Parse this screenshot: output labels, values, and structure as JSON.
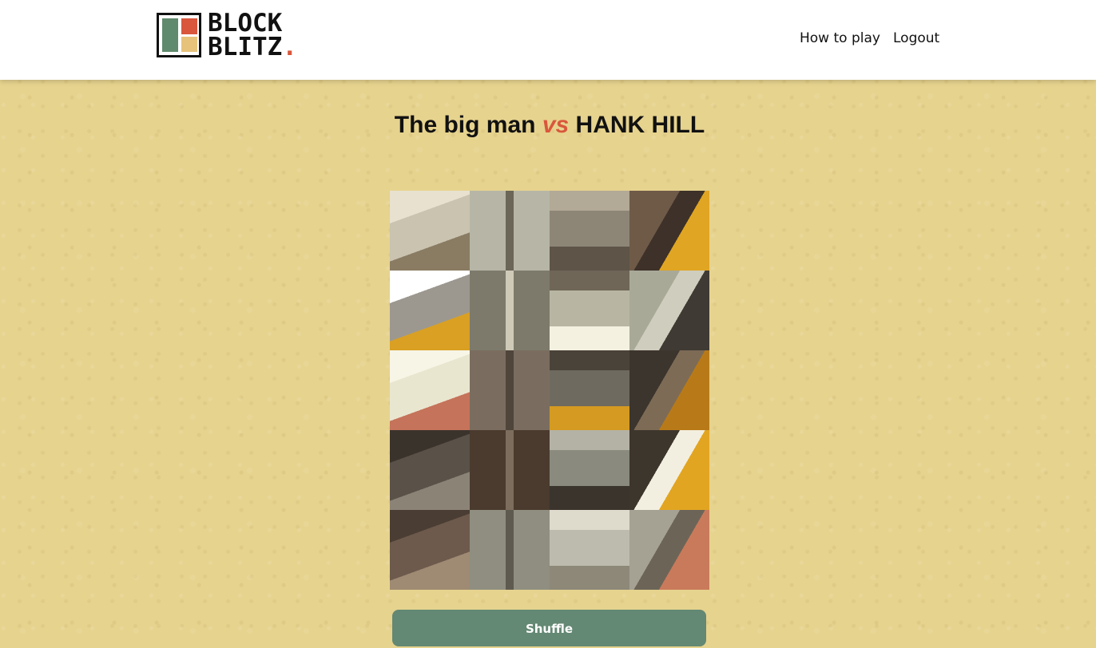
{
  "header": {
    "logo_line1": "BLOCK",
    "logo_line2": "BLITZ",
    "logo_dot": ".",
    "nav": {
      "how_to_play": "How to play",
      "logout": "Logout"
    }
  },
  "match": {
    "player1": "The big man",
    "vs": "vs",
    "player2": "HANK HILL"
  },
  "puzzle": {
    "tiles": [
      {
        "bg": "#c9c3b0",
        "accent": "#8a7b63",
        "accent2": "#e8e1cf"
      },
      {
        "bg": "#b7b6a6",
        "accent": "#d4a028",
        "accent2": "#6b6658"
      },
      {
        "bg": "#8d8677",
        "accent": "#5e5448",
        "accent2": "#b2a996"
      },
      {
        "bg": "#6f5a48",
        "accent": "#e0a523",
        "accent2": "#3d3129"
      },
      {
        "bg": "#9c9890",
        "accent": "#d9a023",
        "accent2": "#ffffff"
      },
      {
        "bg": "#7d7a6b",
        "accent": "#a9a591",
        "accent2": "#cfcab8"
      },
      {
        "bg": "#b8b6a3",
        "accent": "#f4f1e1",
        "accent2": "#6f6657"
      },
      {
        "bg": "#a9a998",
        "accent": "#3f3a33",
        "accent2": "#cfcdbd"
      },
      {
        "bg": "#e9e6d0",
        "accent": "#c5735a",
        "accent2": "#f7f5e6"
      },
      {
        "bg": "#7a6d5f",
        "accent": "#a38464",
        "accent2": "#4f453b"
      },
      {
        "bg": "#6f6a5f",
        "accent": "#d49a22",
        "accent2": "#4a4339"
      },
      {
        "bg": "#3c352d",
        "accent": "#b87a18",
        "accent2": "#7d6b56"
      },
      {
        "bg": "#5a5148",
        "accent": "#8c8377",
        "accent2": "#3a332c"
      },
      {
        "bg": "#4a3b2e",
        "accent": "#d3941c",
        "accent2": "#7c6d5c"
      },
      {
        "bg": "#8a8a7e",
        "accent": "#3a342d",
        "accent2": "#b4b2a5"
      },
      {
        "bg": "#3d362d",
        "accent": "#e2a521",
        "accent2": "#f3efe0"
      },
      {
        "bg": "#6d5a4c",
        "accent": "#9f8a73",
        "accent2": "#4a3d33"
      },
      {
        "bg": "#8f8e80",
        "accent": "#c87e22",
        "accent2": "#5f5a50"
      },
      {
        "bg": "#bdbbad",
        "accent": "#8d8878",
        "accent2": "#dedbcc"
      },
      {
        "bg": "#a5a193",
        "accent": "#c97a5b",
        "accent2": "#6c6557"
      }
    ]
  },
  "actions": {
    "shuffle": "Shuffle"
  }
}
